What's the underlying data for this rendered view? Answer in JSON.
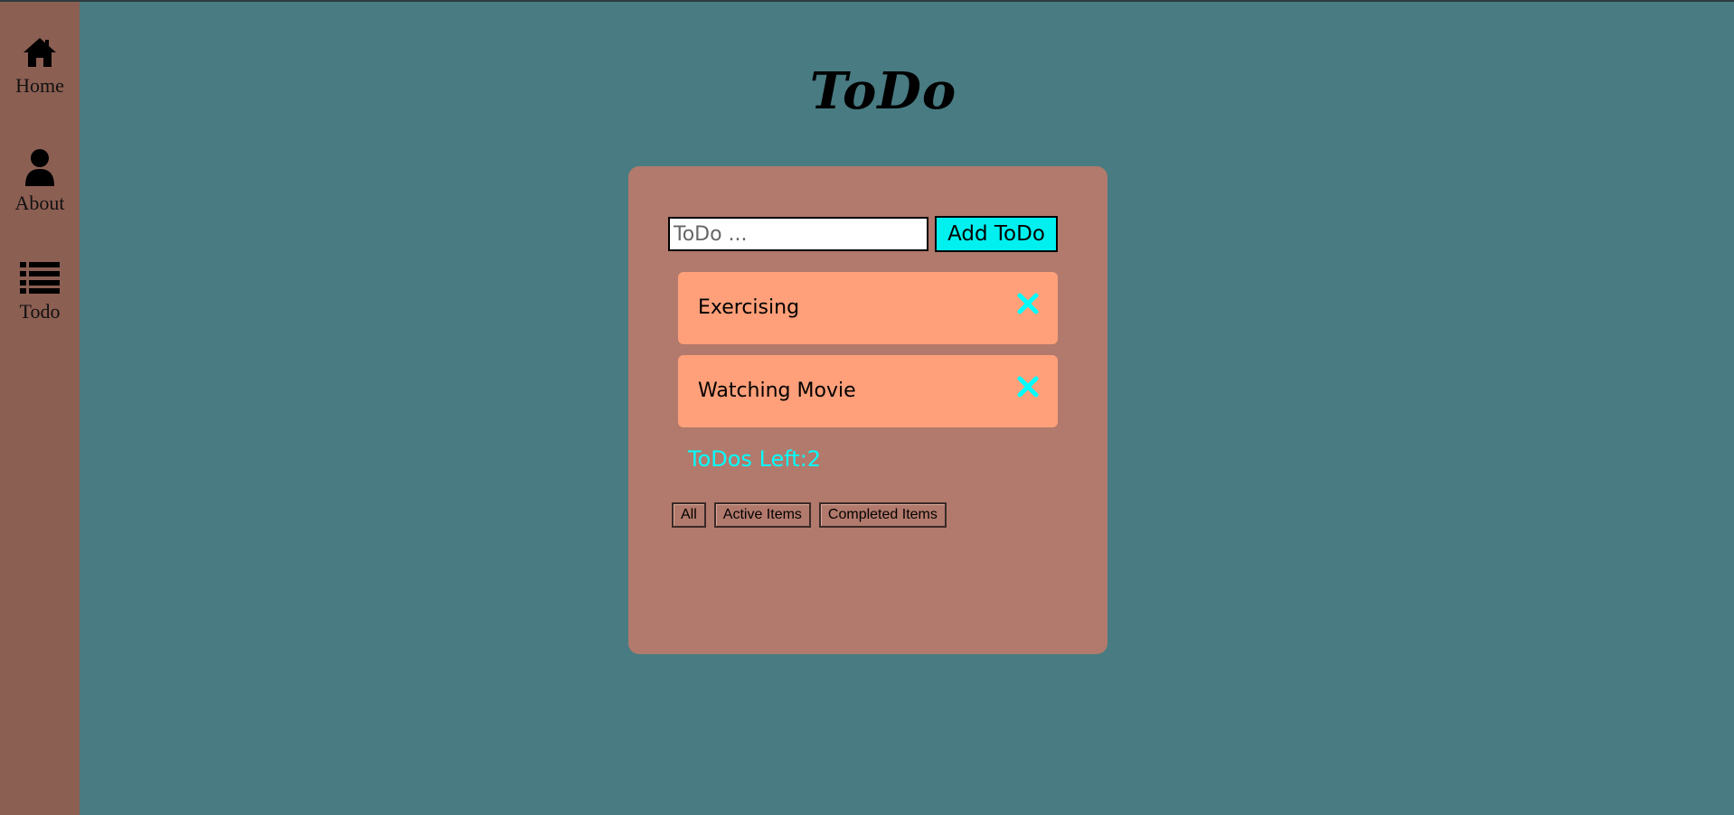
{
  "sidebar": {
    "items": [
      {
        "label": "Home",
        "icon": "home-icon"
      },
      {
        "label": "About",
        "icon": "user-icon"
      },
      {
        "label": "Todo",
        "icon": "list-icon"
      }
    ]
  },
  "header": {
    "title": "ToDo"
  },
  "form": {
    "input_placeholder": "ToDo ...",
    "input_value": "",
    "add_button_label": "Add ToDo"
  },
  "todos": [
    {
      "text": "Exercising",
      "delete_icon": "close-icon"
    },
    {
      "text": "Watching Movie",
      "delete_icon": "close-icon"
    }
  ],
  "status": {
    "todos_left_text": "ToDos Left:2"
  },
  "filters": [
    {
      "label": "All"
    },
    {
      "label": "Active Items"
    },
    {
      "label": "Completed Items"
    }
  ],
  "colors": {
    "background": "#487b82",
    "sidebar": "#8c5f53",
    "card": "#b27a6c",
    "todo_item": "#ffa07a",
    "accent": "#00f0f0"
  }
}
